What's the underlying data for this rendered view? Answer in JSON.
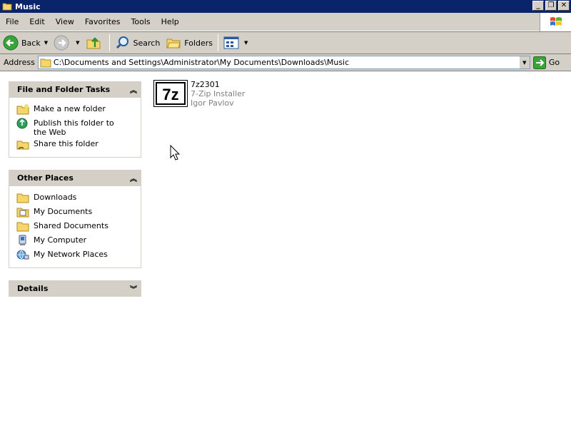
{
  "window": {
    "title": "Music"
  },
  "menu": [
    "File",
    "Edit",
    "View",
    "Favorites",
    "Tools",
    "Help"
  ],
  "toolbar": {
    "back_label": "Back",
    "search_label": "Search",
    "folders_label": "Folders"
  },
  "address": {
    "label": "Address",
    "path": "C:\\Documents and Settings\\Administrator\\My Documents\\Downloads\\Music",
    "go_label": "Go"
  },
  "tasks": {
    "title": "File and Folder Tasks",
    "items": [
      "Make a new folder",
      "Publish this folder to the Web",
      "Share this folder"
    ]
  },
  "other_places": {
    "title": "Other Places",
    "items": [
      "Downloads",
      "My Documents",
      "Shared Documents",
      "My Computer",
      "My Network Places"
    ]
  },
  "details": {
    "title": "Details"
  },
  "files": [
    {
      "name": "7z2301",
      "type": "7-Zip Installer",
      "company": "Igor Pavlov",
      "icon": "7z-icon",
      "icon_text": "7z"
    }
  ]
}
